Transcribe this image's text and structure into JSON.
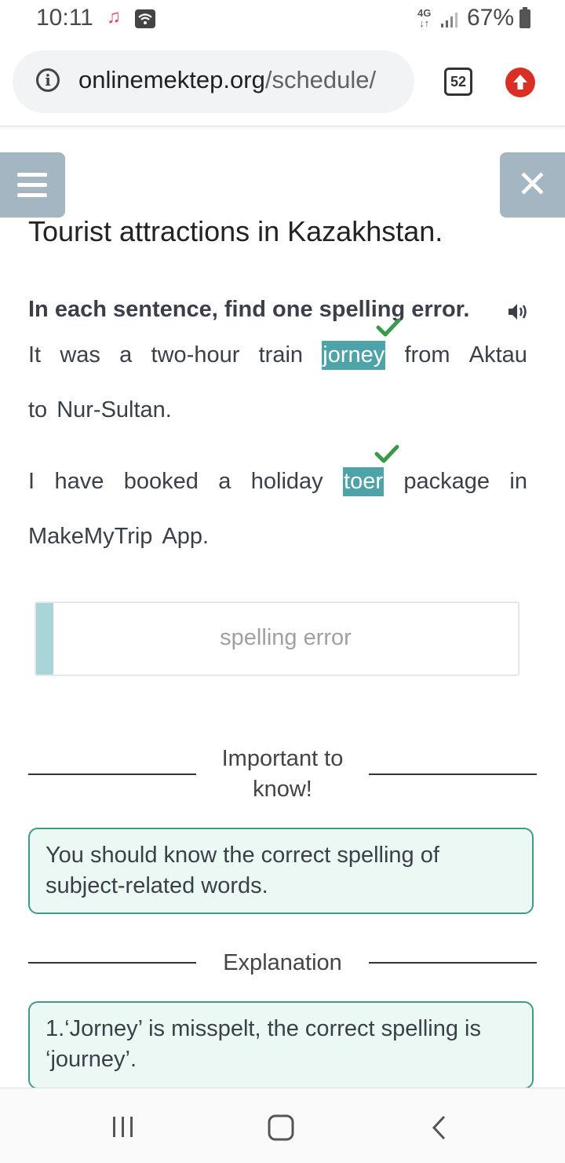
{
  "status_bar": {
    "time": "10:11",
    "network": "4G",
    "battery": "67%",
    "icons": [
      "music-icon",
      "wifi-icon",
      "signal-icon",
      "battery-icon"
    ]
  },
  "browser": {
    "url_domain": "onlinemektep.org",
    "url_path": "/schedule/",
    "tabs_count": "52",
    "icons": [
      "info-icon",
      "upload-icon"
    ]
  },
  "page": {
    "title": "Tourist attractions in Kazakhstan.",
    "instruction": "In each sentence, find one spelling error.",
    "sentences": [
      {
        "line1": [
          "It",
          "was",
          "a",
          "two-hour",
          "train",
          "jorney",
          "from",
          "Aktau"
        ],
        "line2": [
          "to",
          "Nur-Sultan."
        ],
        "error_word": "jorney"
      },
      {
        "line1": [
          "I",
          "have",
          "booked",
          "a",
          "holiday",
          "toer",
          "package",
          "in"
        ],
        "line2": [
          "MakeMyTrip",
          "App."
        ],
        "error_word": "toer"
      }
    ],
    "answer_box_label": "spelling error",
    "important_title": "Important to know!",
    "important_text": "You should know the correct spelling of subject-related words.",
    "explanation_title": "Explanation",
    "explanation_text": "1.‘Jorney’ is misspelt, the correct spelling is ‘journey’."
  },
  "colors": {
    "accent_teal": "#4da3a8",
    "side_button": "#a5b6c3",
    "check_green": "#3a9a4a",
    "info_border": "#3e9a8a",
    "upload_red": "#d93025"
  }
}
